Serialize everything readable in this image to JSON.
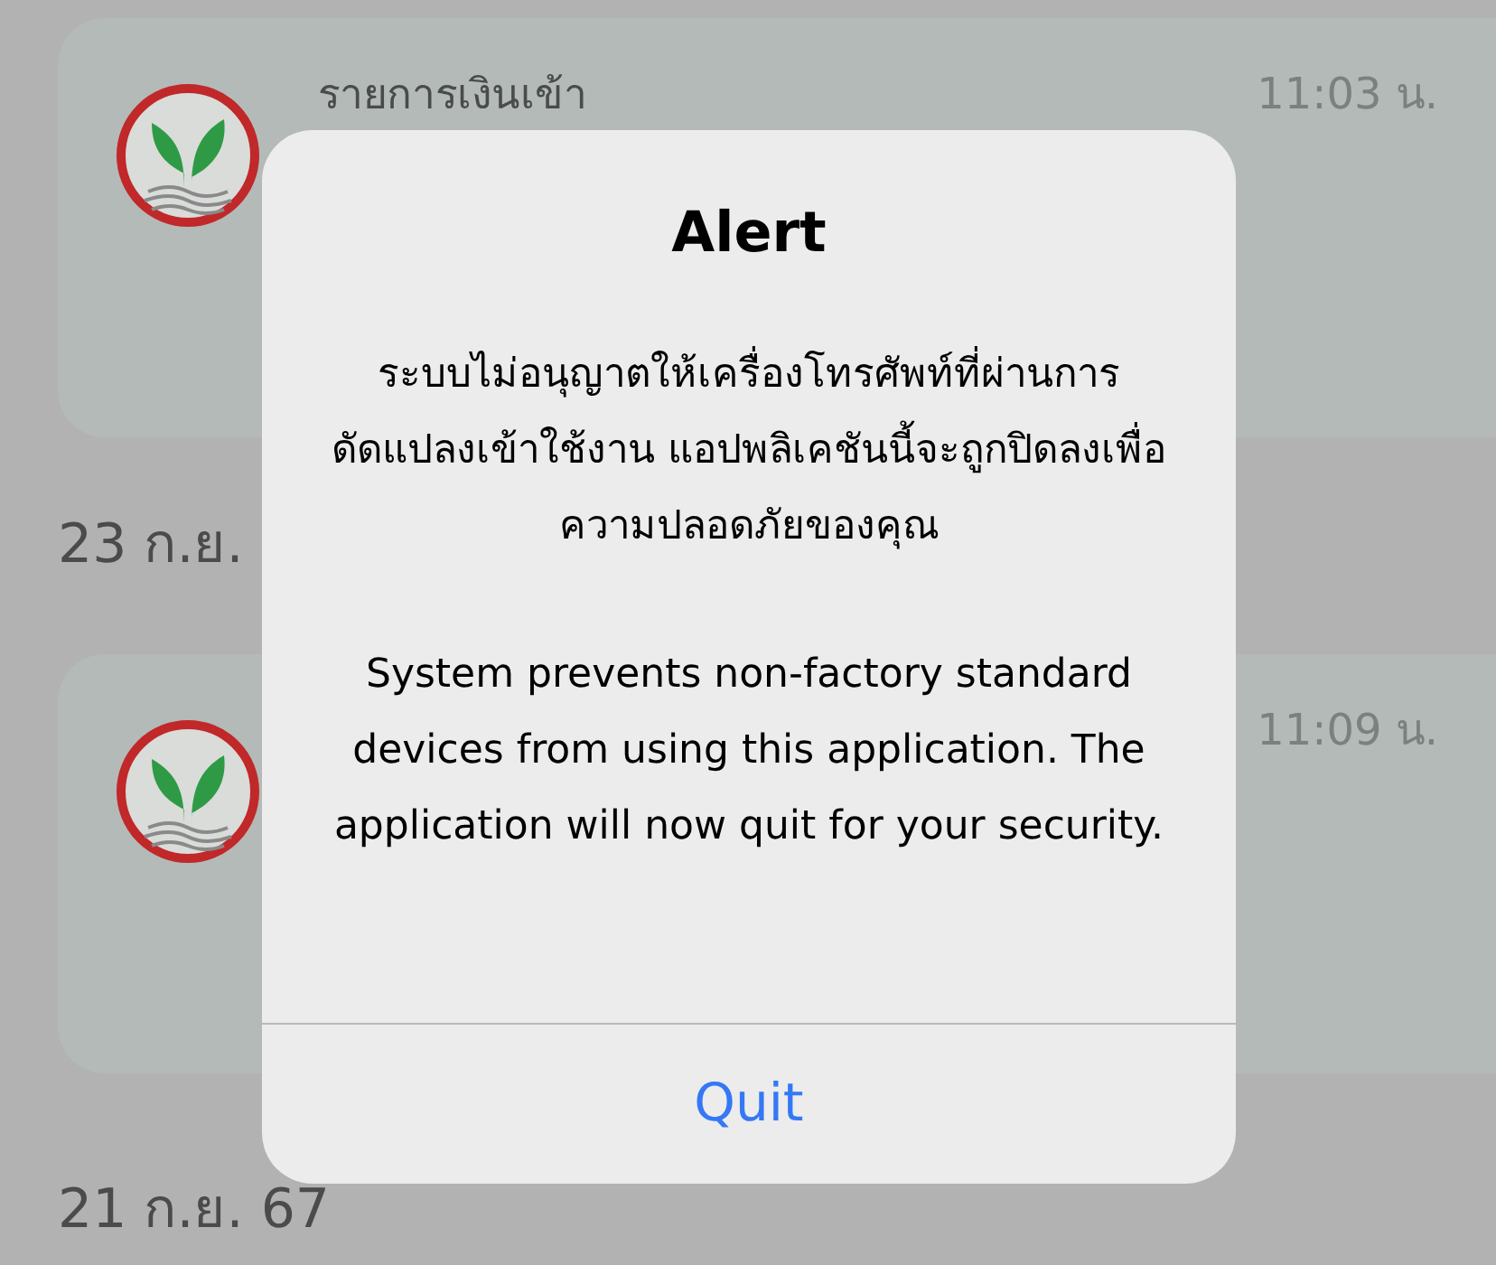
{
  "feed": [
    {
      "kind": "notification",
      "title": "รายการเงินเข้า",
      "time": "11:03 น."
    },
    {
      "kind": "date",
      "text": "23 ก.ย."
    },
    {
      "kind": "notification",
      "time": "11:09 น."
    },
    {
      "kind": "date",
      "text": "21 ก.ย. 67"
    }
  ],
  "alert": {
    "title": "Alert",
    "message": [
      "ระบบไม่อนุญาตให้เครื่องโทรศัพท์ที่ผ่านการดัดแปลงเข้าใช้งาน แอปพลิเคชันนี้จะถูกปิดลงเพื่อความปลอดภัยของคุณ",
      "System prevents non-factory standard devices from using this application. The application will now quit for your security."
    ],
    "buttons": [
      "Quit"
    ]
  }
}
